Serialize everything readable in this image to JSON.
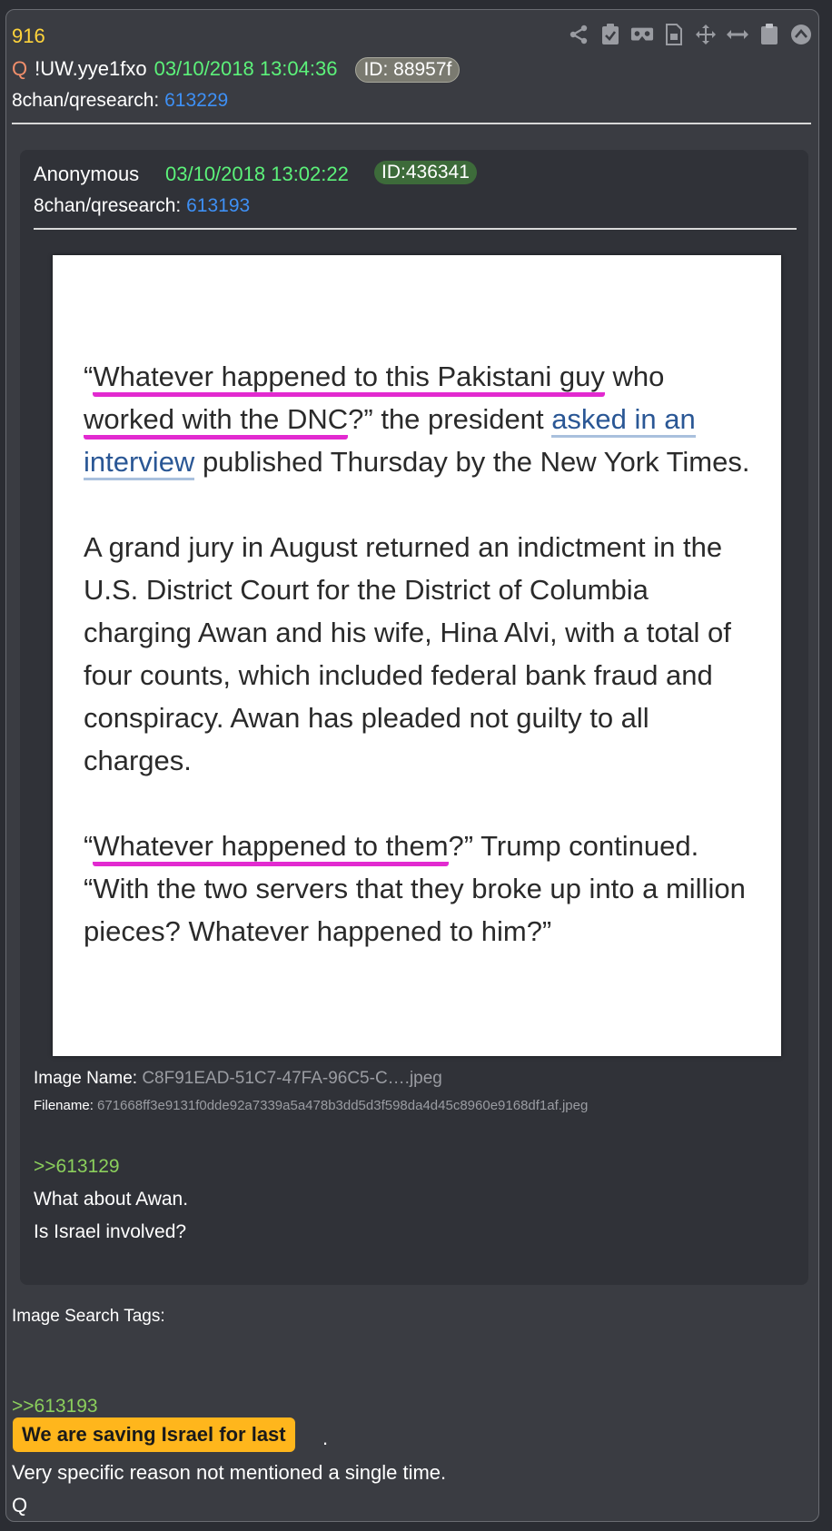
{
  "post": {
    "number": "916",
    "q_label": "Q",
    "tripcode": "!UW.yye1fxo",
    "datetime": "03/10/2018 13:04:36",
    "id_pill": "ID: 88957f",
    "board_prefix": "8chan/qresearch:",
    "board_post": "613229"
  },
  "toolbar": {
    "icons": [
      "share-icon",
      "clipboard-check-icon",
      "vr-glasses-icon",
      "document-icon",
      "move-icon",
      "expand-horizontal-icon",
      "clipboard-icon",
      "scroll-up-icon"
    ]
  },
  "quoted": {
    "author": "Anonymous",
    "datetime": "03/10/2018 13:02:22",
    "id_pill": "ID:436341",
    "board_prefix": "8chan/qresearch:",
    "board_post": "613193",
    "article": {
      "p1_a": "“",
      "p1_hl1": "Whatever happened to this Pakistani guy",
      "p1_b": " who ",
      "p1_hl2": "worked with the DNC",
      "p1_c": "?” the president ",
      "p1_link": "asked in an interview",
      "p1_d": " published Thursday by the New York Times.",
      "p2": "A grand jury in August returned an indictment in the U.S. District Court for the District of Columbia charging Awan and his wife, Hina Alvi, with a total of four counts, which included federal bank fraud and conspiracy. Awan has pleaded not guilty to all charges.",
      "p3_a": "“",
      "p3_hl": "Whatever happened to them",
      "p3_b": "?” Trump continued. “With the two servers that they broke up into a million pieces? Whatever happened to him?”"
    },
    "image_name_label": "Image Name:",
    "image_name": "C8F91EAD-51C7-47FA-96C5-C….jpeg",
    "filename_label": "Filename:",
    "filename": "671668ff3e9131f0dde92a7339a5a478b3dd5d3f598da4d45c8960e9168df1af.jpeg",
    "reply_link": ">>613129",
    "line1": "What about Awan.",
    "line2": "Is Israel involved?"
  },
  "footer": {
    "tags_label": "Image Search Tags:",
    "reply_link": ">>613193",
    "highlight": "We are saving Israel for last",
    "after_highlight": ".",
    "line1": "Very specific reason not mentioned a single time.",
    "sign": "Q"
  },
  "colors": {
    "background": "#3a3c42",
    "post_number": "#ffd43b",
    "date_green": "#5cf27a",
    "link_blue": "#3e90f5",
    "greentext": "#8bcf5c",
    "highlight": "#ffb61c",
    "annotation_magenta": "#e22ad0"
  }
}
